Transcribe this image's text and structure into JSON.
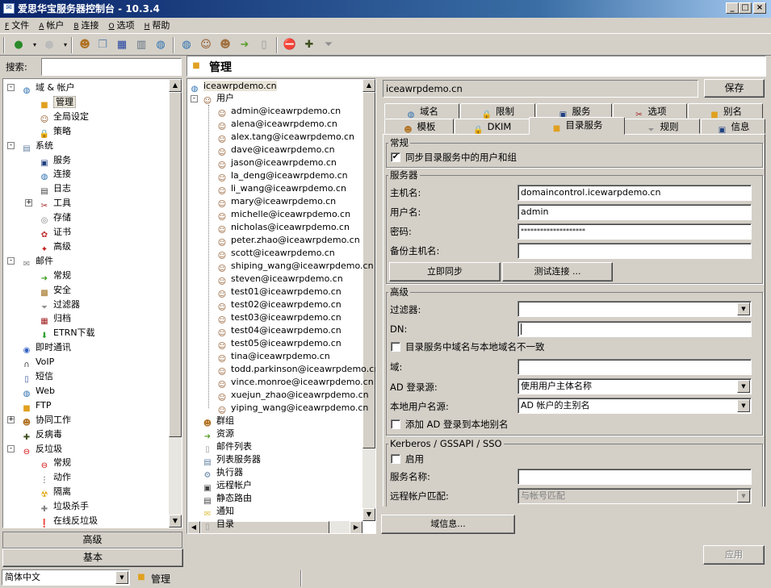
{
  "window": {
    "title": "爱思华宝服务器控制台 - 10.3.4"
  },
  "menu": [
    {
      "key": "F",
      "label": "文件"
    },
    {
      "key": "A",
      "label": "帐户"
    },
    {
      "key": "B",
      "label": "连接"
    },
    {
      "key": "O",
      "label": "选项"
    },
    {
      "key": "H",
      "label": "帮助"
    }
  ],
  "search": {
    "label": "搜索:",
    "value": ""
  },
  "header": {
    "title": "管理"
  },
  "nav_tree": [
    {
      "label": "域 & 帐户",
      "level": 0,
      "icon": "globe-icon",
      "exp": "-"
    },
    {
      "label": "管理",
      "level": 1,
      "icon": "folder-lock-icon",
      "selected": true
    },
    {
      "label": "全局设定",
      "level": 1,
      "icon": "user-gear-icon"
    },
    {
      "label": "策略",
      "level": 1,
      "icon": "lock-icon"
    },
    {
      "label": "系统",
      "level": 0,
      "icon": "server-icon",
      "exp": "-"
    },
    {
      "label": "服务",
      "level": 1,
      "icon": "monitor-icon"
    },
    {
      "label": "连接",
      "level": 1,
      "icon": "globe-icon"
    },
    {
      "label": "日志",
      "level": 1,
      "icon": "log-icon"
    },
    {
      "label": "工具",
      "level": 1,
      "icon": "tools-icon",
      "exp": "+"
    },
    {
      "label": "存储",
      "level": 1,
      "icon": "storage-icon"
    },
    {
      "label": "证书",
      "level": 1,
      "icon": "certificate-icon"
    },
    {
      "label": "高级",
      "level": 1,
      "icon": "advanced-icon"
    },
    {
      "label": "邮件",
      "level": 0,
      "icon": "mail-icon",
      "exp": "-"
    },
    {
      "label": "常规",
      "level": 1,
      "icon": "arrow-icon"
    },
    {
      "label": "安全",
      "level": 1,
      "icon": "shield-icon"
    },
    {
      "label": "过滤器",
      "level": 1,
      "icon": "filter-icon"
    },
    {
      "label": "归档",
      "level": 1,
      "icon": "archive-icon"
    },
    {
      "label": "ETRN下载",
      "level": 1,
      "icon": "download-icon"
    },
    {
      "label": "即时通讯",
      "level": 0,
      "icon": "chat-icon"
    },
    {
      "label": "VoIP",
      "level": 0,
      "icon": "headset-icon"
    },
    {
      "label": "短信",
      "level": 0,
      "icon": "sms-icon"
    },
    {
      "label": "Web",
      "level": 0,
      "icon": "web-icon"
    },
    {
      "label": "FTP",
      "level": 0,
      "icon": "ftp-icon"
    },
    {
      "label": "协同工作",
      "level": 0,
      "icon": "groupware-icon",
      "exp": "+"
    },
    {
      "label": "反病毒",
      "level": 0,
      "icon": "antivirus-icon"
    },
    {
      "label": "反垃圾",
      "level": 0,
      "icon": "antispam-icon",
      "exp": "-"
    },
    {
      "label": "常规",
      "level": 1,
      "icon": "stop-icon"
    },
    {
      "label": "动作",
      "level": 1,
      "icon": "traffic-light-icon"
    },
    {
      "label": "隔离",
      "level": 1,
      "icon": "quarantine-icon"
    },
    {
      "label": "垃圾杀手",
      "level": 1,
      "icon": "spamkiller-icon"
    },
    {
      "label": "在线反垃圾",
      "level": 1,
      "icon": "online-antispam-icon"
    }
  ],
  "left_buttons": {
    "advanced": "高级",
    "basic": "基本"
  },
  "domain_tree": {
    "root": "iceawrpdemo.cn",
    "users_label": "用户",
    "users": [
      "admin@iceawrpdemo.cn",
      "alena@iceawrpdemo.cn",
      "alex.tang@iceawrpdemo.cn",
      "dave@iceawrpdemo.cn",
      "jason@iceawrpdemo.cn",
      "la_deng@iceawrpdemo.cn",
      "li_wang@iceawrpdemo.cn",
      "mary@iceawrpdemo.cn",
      "michelle@iceawrpdemo.cn",
      "nicholas@iceawrpdemo.cn",
      "peter.zhao@iceawrpdemo.cn",
      "scott@iceawrpdemo.cn",
      "shiping_wang@iceawrpdemo.cn",
      "steven@iceawrpdemo.cn",
      "test01@iceawrpdemo.cn",
      "test02@iceawrpdemo.cn",
      "test03@iceawrpdemo.cn",
      "test04@iceawrpdemo.cn",
      "test05@iceawrpdemo.cn",
      "tina@iceawrpdemo.cn",
      "todd.parkinson@iceawrpdemo.cn",
      "vince.monroe@iceawrpdemo.cn",
      "xuejun_zhao@iceawrpdemo.cn",
      "yiping_wang@iceawrpdemo.cn"
    ],
    "others": [
      "群组",
      "资源",
      "邮件列表",
      "列表服务器",
      "执行器",
      "远程帐户",
      "静态路由",
      "通知",
      "目录"
    ]
  },
  "domain_bar": {
    "value": "iceawrpdemo.cn",
    "save": "保存"
  },
  "tabs_row1": [
    "域名",
    "限制",
    "服务",
    "选项",
    "别名"
  ],
  "tabs_row2": [
    "模板",
    "DKIM",
    "目录服务",
    "规则",
    "信息"
  ],
  "form": {
    "general_title": "常规",
    "sync_label": "同步目录服务中的用户和组",
    "sync_checked": "✔",
    "server_title": "服务器",
    "host_label": "主机名:",
    "host_value": "domaincontrol.icewarpdemo.cn",
    "user_label": "用户名:",
    "user_value": "admin",
    "pass_label": "密码:",
    "pass_value": "********************",
    "backup_label": "备份主机名:",
    "backup_value": "",
    "sync_now": "立即同步",
    "test_conn": "测试连接 ...",
    "adv_title": "高级",
    "filter_label": "过滤器:",
    "filter_value": "",
    "dn_label": "DN:",
    "dn_value": "",
    "mismatch_label": "目录服务中域名与本地域名不一致",
    "domain_label": "域:",
    "domain_value": "",
    "ad_login_label": "AD 登录源:",
    "ad_login_value": "使用用户主体名称",
    "local_user_label": "本地用户名源:",
    "local_user_value": "AD 帐户的主别名",
    "add_alias_label": "添加 AD 登录到本地别名",
    "kerberos_title": "Kerberos / GSSAPI / SSO",
    "enable_label": "启用",
    "svc_label": "服务名称:",
    "svc_value": "",
    "remote_label": "远程帐户匹配:",
    "remote_value": "与帐号匹配"
  },
  "bottom": {
    "domain_info": "域信息...",
    "apply": "应用"
  },
  "status": {
    "lang": "简体中文",
    "section": "管理"
  }
}
